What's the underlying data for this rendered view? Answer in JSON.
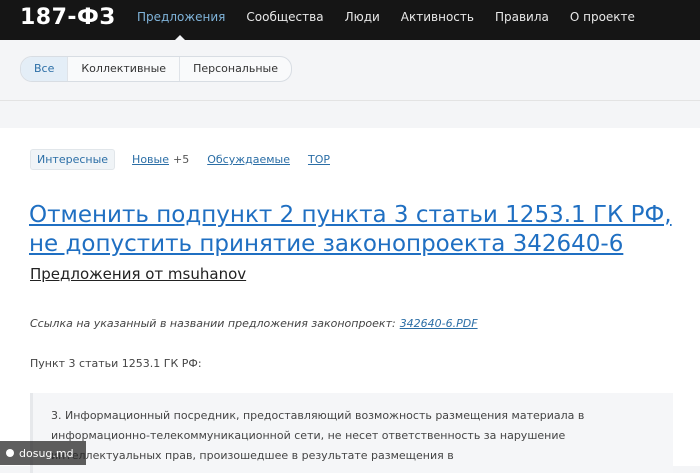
{
  "site": {
    "logo": "187-ФЗ"
  },
  "nav": {
    "items": [
      "Предложения",
      "Сообщества",
      "Люди",
      "Активность",
      "Правила",
      "О проекте"
    ],
    "active_index": 0
  },
  "filters": {
    "items": [
      "Все",
      "Коллективные",
      "Персональные"
    ],
    "active_index": 0
  },
  "subtabs": {
    "interesting": "Интересные",
    "new": "Новые",
    "new_count": "+5",
    "discussed": "Обсуждаемые",
    "top": "TOP"
  },
  "proposal": {
    "title": "Отменить подпункт 2 пункта 3 статьи 1253.1 ГК РФ, не допустить принятие законопроекта 342640-6",
    "author_line": "Предложения от msuhanov",
    "link_text": "Ссылка на указанный в названии предложения законопроект:",
    "link_label": "342640-6.PDF",
    "point_heading": "Пункт 3 статьи 1253.1 ГК РФ:",
    "quote": "3. Информационный посредник, предоставляющий возможность размещения материала в информационно-телекоммуникационной сети, не несет ответственность за нарушение интеллектуальных прав, произошедшее в результате размещения в"
  },
  "watermark": {
    "text": "dosug.md"
  },
  "colors": {
    "topbar": "#151515",
    "link": "#1f6fc2",
    "active_nav": "#7fb3d9"
  }
}
